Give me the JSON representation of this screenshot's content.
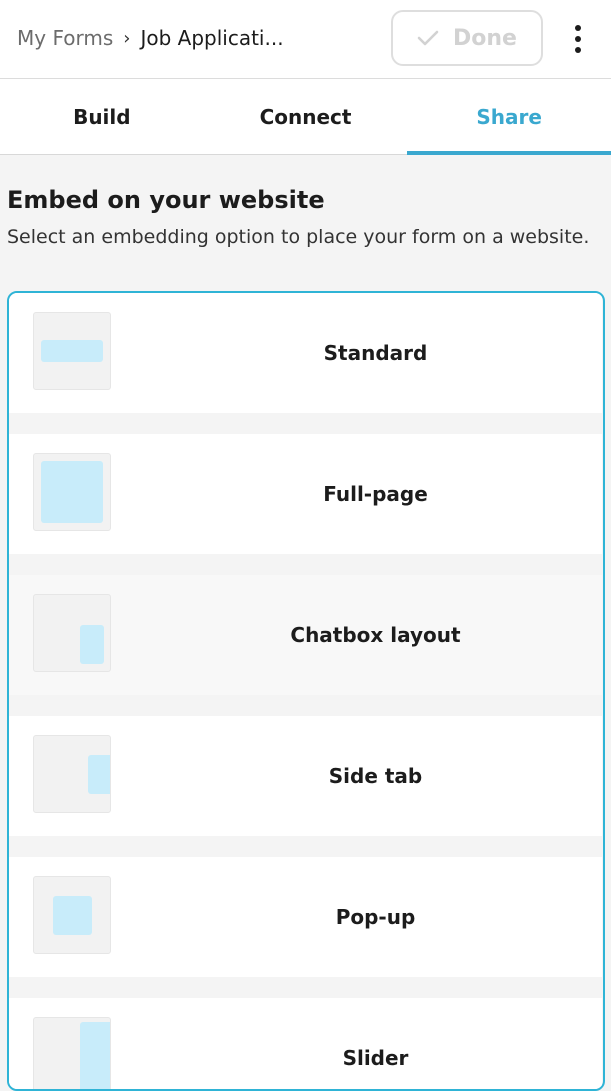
{
  "header": {
    "breadcrumb_root": "My Forms",
    "breadcrumb_separator": "›",
    "breadcrumb_current": "Job Applicati...",
    "done_label": "Done",
    "more_icon": "more-vertical-icon"
  },
  "tabs": [
    {
      "label": "Build",
      "active": false
    },
    {
      "label": "Connect",
      "active": false
    },
    {
      "label": "Share",
      "active": true
    }
  ],
  "section": {
    "title": "Embed on your website",
    "description": "Select an embedding option to place your form on a website."
  },
  "options": [
    {
      "label": "Standard",
      "icon": "standard-embed-icon"
    },
    {
      "label": "Full-page",
      "icon": "full-page-embed-icon"
    },
    {
      "label": "Chatbox layout",
      "icon": "chatbox-embed-icon"
    },
    {
      "label": "Side tab",
      "icon": "side-tab-embed-icon"
    },
    {
      "label": "Pop-up",
      "icon": "popup-embed-icon"
    },
    {
      "label": "Slider",
      "icon": "slider-embed-icon"
    }
  ],
  "colors": {
    "accent": "#3aa8cf",
    "selection_border": "#2fb4d6",
    "thumbnail_fill": "#c8ecfa",
    "page_background": "#f4f4f4"
  }
}
